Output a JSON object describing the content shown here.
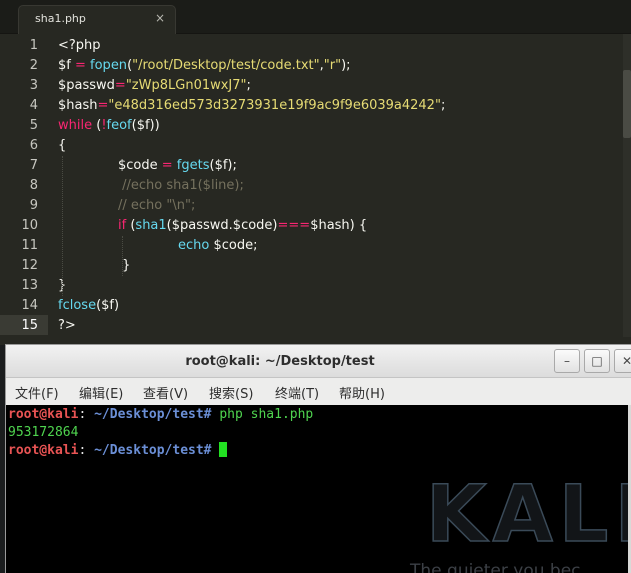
{
  "editor": {
    "tab": {
      "label": "sha1.php",
      "close": "×"
    },
    "line_numbers": [
      "1",
      "2",
      "3",
      "4",
      "5",
      "6",
      "7",
      "8",
      "9",
      "10",
      "11",
      "12",
      "13",
      "14",
      "15"
    ],
    "active_line": 15,
    "lines": [
      {
        "indent": 0,
        "tokens": [
          {
            "t": "<?php",
            "c": "plain"
          }
        ]
      },
      {
        "indent": 0,
        "tokens": [
          {
            "t": "$f",
            "c": "plain"
          },
          {
            "t": " = ",
            "c": "kw"
          },
          {
            "t": "fopen",
            "c": "fn"
          },
          {
            "t": "(",
            "c": "plain"
          },
          {
            "t": "\"/root/Desktop/test/code.txt\"",
            "c": "str"
          },
          {
            "t": ",",
            "c": "plain"
          },
          {
            "t": "\"r\"",
            "c": "str"
          },
          {
            "t": ");",
            "c": "plain"
          }
        ]
      },
      {
        "indent": 0,
        "tokens": [
          {
            "t": "$passwd",
            "c": "plain"
          },
          {
            "t": "=",
            "c": "kw"
          },
          {
            "t": "\"zWp8LGn01wxJ7\"",
            "c": "str"
          },
          {
            "t": ";",
            "c": "plain"
          }
        ]
      },
      {
        "indent": 0,
        "tokens": [
          {
            "t": "$hash",
            "c": "plain"
          },
          {
            "t": "=",
            "c": "kw"
          },
          {
            "t": "\"e48d316ed573d3273931e19f9ac9f9e6039a4242\"",
            "c": "str"
          },
          {
            "t": ";",
            "c": "plain"
          }
        ]
      },
      {
        "indent": 0,
        "tokens": [
          {
            "t": "while",
            "c": "kw"
          },
          {
            "t": " (",
            "c": "plain"
          },
          {
            "t": "!",
            "c": "kw"
          },
          {
            "t": "feof",
            "c": "fn"
          },
          {
            "t": "($f))",
            "c": "plain"
          }
        ]
      },
      {
        "indent": 0,
        "tokens": [
          {
            "t": "{",
            "c": "plain"
          }
        ]
      },
      {
        "indent": 1,
        "tokens": [
          {
            "t": "$code",
            "c": "plain"
          },
          {
            "t": " = ",
            "c": "kw"
          },
          {
            "t": "fgets",
            "c": "fn"
          },
          {
            "t": "($f);",
            "c": "plain"
          }
        ]
      },
      {
        "indent": 1,
        "tokens": [
          {
            "t": " //echo sha1($line);",
            "c": "cm"
          }
        ]
      },
      {
        "indent": 1,
        "tokens": [
          {
            "t": "// echo \"\\n\";",
            "c": "cm"
          }
        ]
      },
      {
        "indent": 1,
        "tokens": [
          {
            "t": "if",
            "c": "kw"
          },
          {
            "t": " (",
            "c": "plain"
          },
          {
            "t": "sha1",
            "c": "fn"
          },
          {
            "t": "($passwd.$code)",
            "c": "plain"
          },
          {
            "t": "===",
            "c": "kw"
          },
          {
            "t": "$hash) {",
            "c": "plain"
          }
        ]
      },
      {
        "indent": 2,
        "tokens": [
          {
            "t": "echo",
            "c": "fn"
          },
          {
            "t": " $code;",
            "c": "plain"
          }
        ]
      },
      {
        "indent": 1,
        "tokens": [
          {
            "t": " }",
            "c": "plain"
          }
        ]
      },
      {
        "indent": 0,
        "tokens": [
          {
            "t": "}",
            "c": "plain"
          }
        ]
      },
      {
        "indent": 0,
        "tokens": [
          {
            "t": "fclose",
            "c": "fn"
          },
          {
            "t": "($f)",
            "c": "plain"
          }
        ]
      },
      {
        "indent": 0,
        "tokens": [
          {
            "t": "?>",
            "c": "plain"
          }
        ]
      }
    ]
  },
  "terminal": {
    "title": "root@kali: ~/Desktop/test",
    "buttons": {
      "minimize": "–",
      "maximize": "□",
      "close": "✕"
    },
    "menu": [
      "文件(F)",
      "编辑(E)",
      "查看(V)",
      "搜索(S)",
      "终端(T)",
      "帮助(H)"
    ],
    "prompt": {
      "user": "root@kali",
      "colon": ":",
      "path": " ~/Desktop/test# "
    },
    "command": "php sha1.php",
    "output": "953172864",
    "background_logo": "KALI L",
    "background_tagline": "The quieter you bec"
  },
  "colors": {
    "editor_bg": "#272822",
    "keyword": "#f92672",
    "function": "#66d9ef",
    "string": "#e6db74",
    "comment": "#75715e",
    "prompt_user": "#e85454",
    "prompt_path": "#6b8fd6",
    "terminal_green": "#4fd44f"
  }
}
